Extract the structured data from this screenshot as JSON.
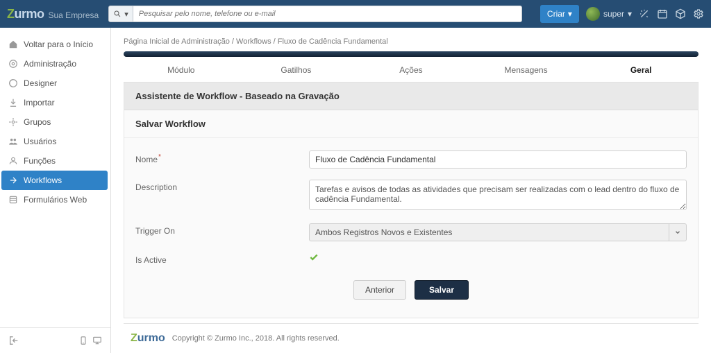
{
  "header": {
    "logo": "Zurmo",
    "company": "Sua Empresa",
    "search_placeholder": "Pesquisar pelo nome, telefone ou e-mail",
    "criar_label": "Criar",
    "user_label": "super"
  },
  "sidebar": {
    "items": [
      {
        "label": "Voltar para o Início"
      },
      {
        "label": "Administração"
      },
      {
        "label": "Designer"
      },
      {
        "label": "Importar"
      },
      {
        "label": "Grupos"
      },
      {
        "label": "Usuários"
      },
      {
        "label": "Funções"
      },
      {
        "label": "Workflows"
      },
      {
        "label": "Formulários Web"
      }
    ]
  },
  "breadcrumb": {
    "a": "Página Inicial de Administração",
    "b": "Workflows",
    "c": "Fluxo de Cadência Fundamental"
  },
  "tabs": {
    "modulo": "Módulo",
    "gatilhos": "Gatilhos",
    "acoes": "Ações",
    "mensagens": "Mensagens",
    "geral": "Geral"
  },
  "panel": {
    "title": "Assistente de Workflow - Baseado na Gravação",
    "subtitle": "Salvar Workflow"
  },
  "form": {
    "name_label": "Nome",
    "name_value": "Fluxo de Cadência Fundamental",
    "desc_label": "Description",
    "desc_value": "Tarefas e avisos de todas as atividades que precisam ser realizadas com o lead dentro do fluxo de cadência Fundamental.",
    "trigger_label": "Trigger On",
    "trigger_value": "Ambos Registros Novos e Existentes",
    "active_label": "Is Active"
  },
  "buttons": {
    "prev": "Anterior",
    "save": "Salvar"
  },
  "footer": {
    "logo": "Zurmo",
    "text": "Copyright © Zurmo Inc., 2018. All rights reserved."
  }
}
